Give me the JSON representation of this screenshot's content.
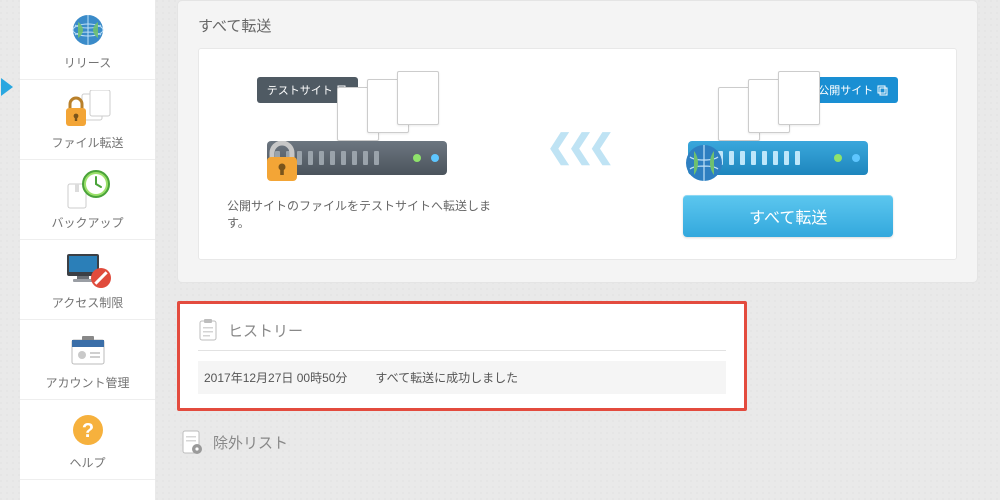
{
  "sidebar": {
    "items": [
      {
        "label": "リリース"
      },
      {
        "label": "ファイル転送"
      },
      {
        "label": "バックアップ"
      },
      {
        "label": "アクセス制限"
      },
      {
        "label": "アカウント管理"
      },
      {
        "label": "ヘルプ"
      }
    ]
  },
  "transfer_panel": {
    "title": "すべて転送",
    "test_tag": "テストサイト",
    "public_tag": "公開サイト",
    "description": "公開サイトのファイルをテストサイトへ転送します。",
    "button": "すべて転送"
  },
  "history": {
    "title": "ヒストリー",
    "entries": [
      {
        "time": "2017年12月27日 00時50分",
        "msg": "すべて転送に成功しました"
      }
    ]
  },
  "exclude": {
    "title": "除外リスト"
  }
}
